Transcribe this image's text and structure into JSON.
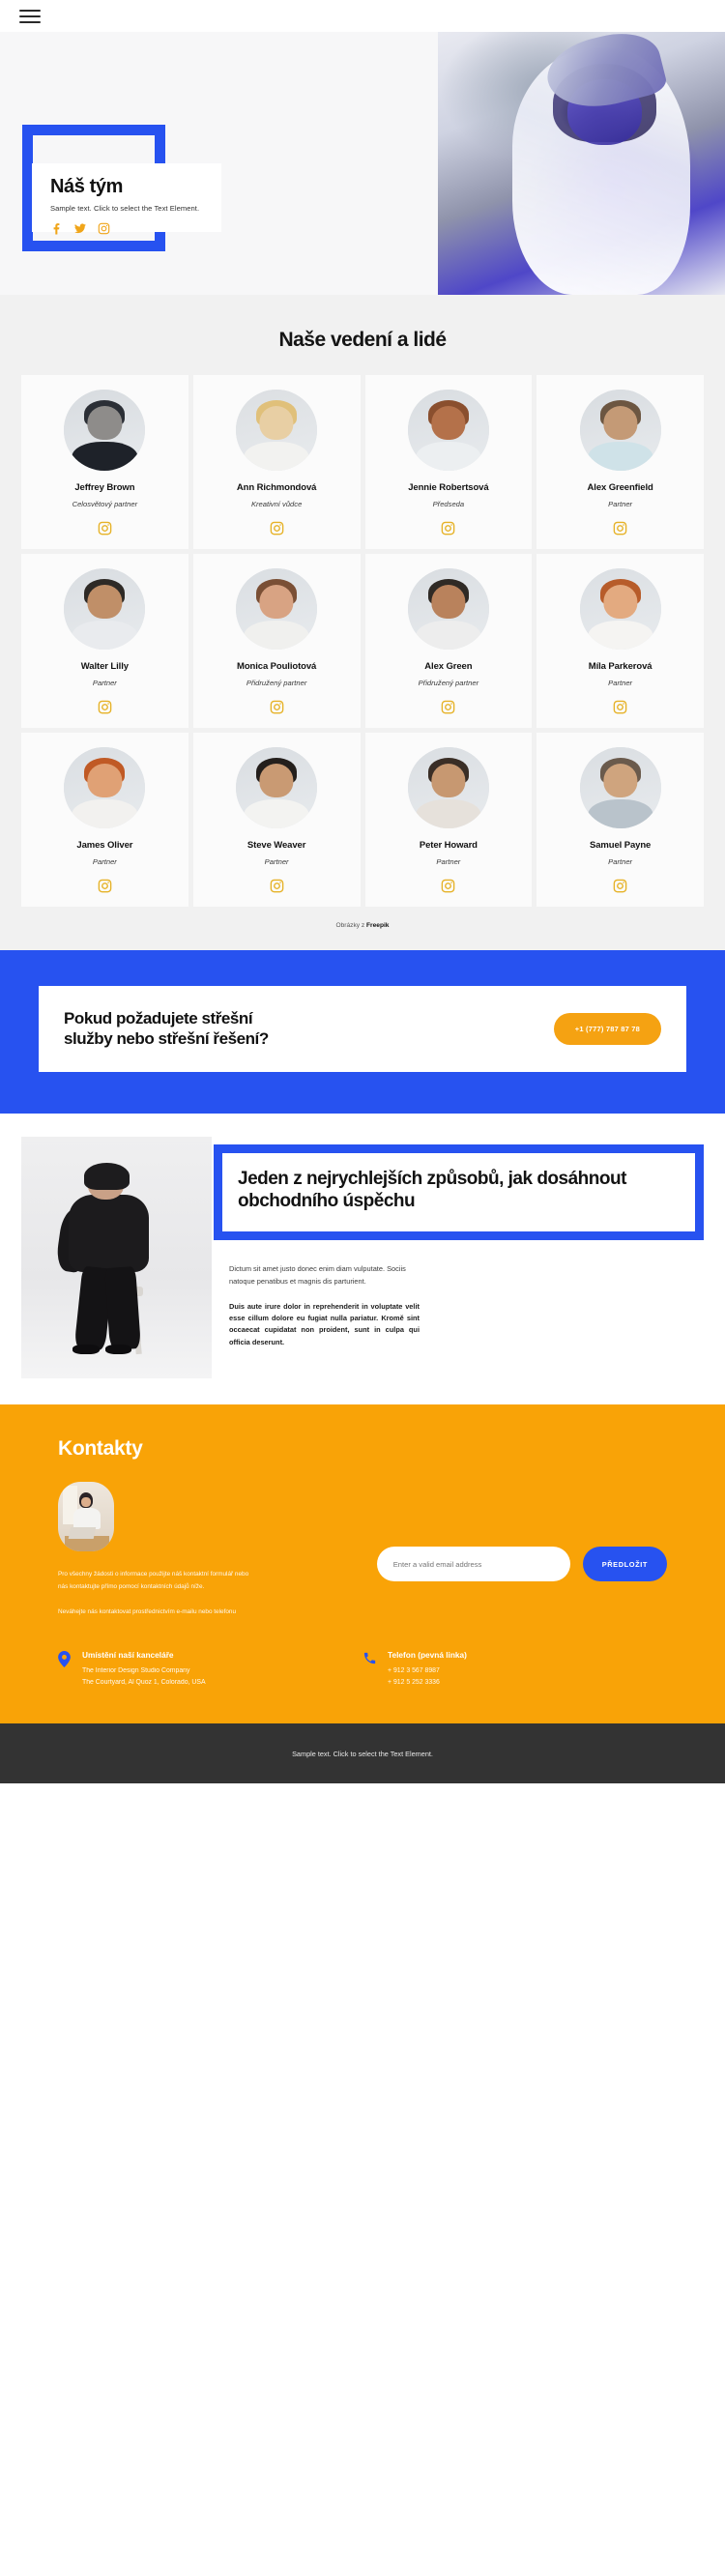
{
  "topbar": {
    "menu_icon": "hamburger-menu-icon"
  },
  "hero": {
    "title": "Náš tým",
    "subtitle": "Sample text. Click to select the Text Element.",
    "social": [
      {
        "name": "facebook-icon",
        "label": "Facebook"
      },
      {
        "name": "twitter-icon",
        "label": "Twitter"
      },
      {
        "name": "instagram-icon",
        "label": "Instagram"
      }
    ]
  },
  "team": {
    "title": "Naše vedení a lidé",
    "credit_prefix": "Obrázky z ",
    "credit_source": "Freepik",
    "social_label": "Instagram",
    "members": [
      {
        "name": "Jeffrey Brown",
        "role": "Celosvětový partner"
      },
      {
        "name": "Ann Richmondová",
        "role": "Kreativní vůdce"
      },
      {
        "name": "Jennie Robertsová",
        "role": "Předseda"
      },
      {
        "name": "Alex Greenfield",
        "role": "Partner"
      },
      {
        "name": "Walter Lilly",
        "role": "Partner"
      },
      {
        "name": "Monica Pouliotová",
        "role": "Přidružený partner"
      },
      {
        "name": "Alex Green",
        "role": "Přidružený partner"
      },
      {
        "name": "Míla Parkerová",
        "role": "Partner"
      },
      {
        "name": "James Oliver",
        "role": "Partner"
      },
      {
        "name": "Steve Weaver",
        "role": "Partner"
      },
      {
        "name": "Peter Howard",
        "role": "Partner"
      },
      {
        "name": "Samuel Payne",
        "role": "Partner"
      }
    ]
  },
  "cta": {
    "line1": "Pokud požadujete střešní",
    "line2": "služby nebo střešní řešení?",
    "phone_button": "+1 (777) 787 87 78"
  },
  "feature": {
    "heading": "Jeden z nejrychlejších způsobů, jak dosáhnout obchodního úspěchu",
    "paragraph1": "Dictum sit amet justo donec enim diam vulputate. Sociis natoque penatibus et magnis dis parturient.",
    "paragraph2": "Duis aute irure dolor in reprehenderit in voluptate velit esse cillum dolore eu fugiat nulla pariatur. Kromě sint occaecat cupidatat non proident, sunt in culpa qui officia deserunt."
  },
  "contacts": {
    "title": "Kontakty",
    "note1": "Pro všechny žádosti o informace použijte náš kontaktní formulář nebo nás kontaktujte přímo pomocí kontaktních údajů níže.",
    "note2": "Neváhejte nás kontaktovat prostřednictvím e-mailu nebo telefonu",
    "email_placeholder": "Enter a valid email address",
    "email_value": "",
    "submit_label": "PŘEDLOŽIT",
    "office": {
      "icon": "map-pin-icon",
      "title": "Umístění naší kanceláře",
      "line1": "The Interior Design Studio Company",
      "line2": "The Courtyard, Al Quoz 1, Colorado,  USA"
    },
    "phone": {
      "icon": "phone-icon",
      "title": "Telefon (pevná linka)",
      "line1": "+ 912 3 567 8987",
      "line2": "+ 912 5 252 3336"
    }
  },
  "footer": {
    "text": "Sample text. Click to select the Text Element."
  },
  "colors": {
    "blue": "#2752f0",
    "orange": "#f9a307",
    "cta_button": "#f5a212",
    "team_bg": "#f1f1f1",
    "footer_bg": "#333333"
  }
}
